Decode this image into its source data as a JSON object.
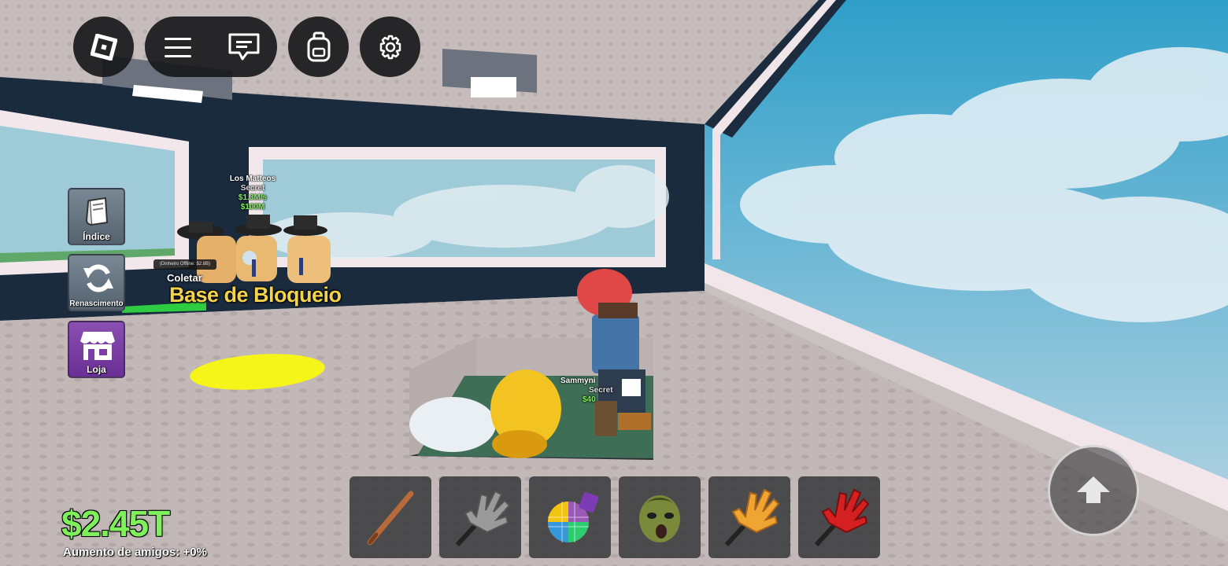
{
  "world": {
    "base_title": "Base de Bloqueio",
    "collect_label": "Coletar",
    "offline_label": "(Dinheiro Offline: $2.8B)",
    "npc_top": {
      "name": "Los Matteos",
      "rarity": "Secret",
      "rate": "$1.3M/s",
      "price": "$100M"
    },
    "npc_bottom": {
      "name": "Sammyni",
      "rarity": "Secret",
      "price": "$40"
    }
  },
  "left_menu": [
    {
      "label": "Índice",
      "icon": "book-icon"
    },
    {
      "label": "Renascimento",
      "icon": "refresh-icon"
    },
    {
      "label": "Loja",
      "icon": "shop-icon"
    }
  ],
  "stats": {
    "money": "$2.45T",
    "friends_boost": "Aumento de amigos: +0%"
  },
  "hotbar": [
    {
      "item": "bat",
      "icon": "baseball-bat-icon"
    },
    {
      "item": "grey glove",
      "icon": "grey-glove-icon"
    },
    {
      "item": "disco ball",
      "icon": "disco-ball-icon"
    },
    {
      "item": "zombie mask",
      "icon": "zombie-head-icon"
    },
    {
      "item": "orange glove",
      "icon": "orange-glove-icon"
    },
    {
      "item": "red glove",
      "icon": "red-glove-icon"
    }
  ],
  "colors": {
    "money_green": "#7df05a",
    "title_yellow": "#f2d34a",
    "hud_bg": "#18181a",
    "sky": "#6fb6d8"
  }
}
